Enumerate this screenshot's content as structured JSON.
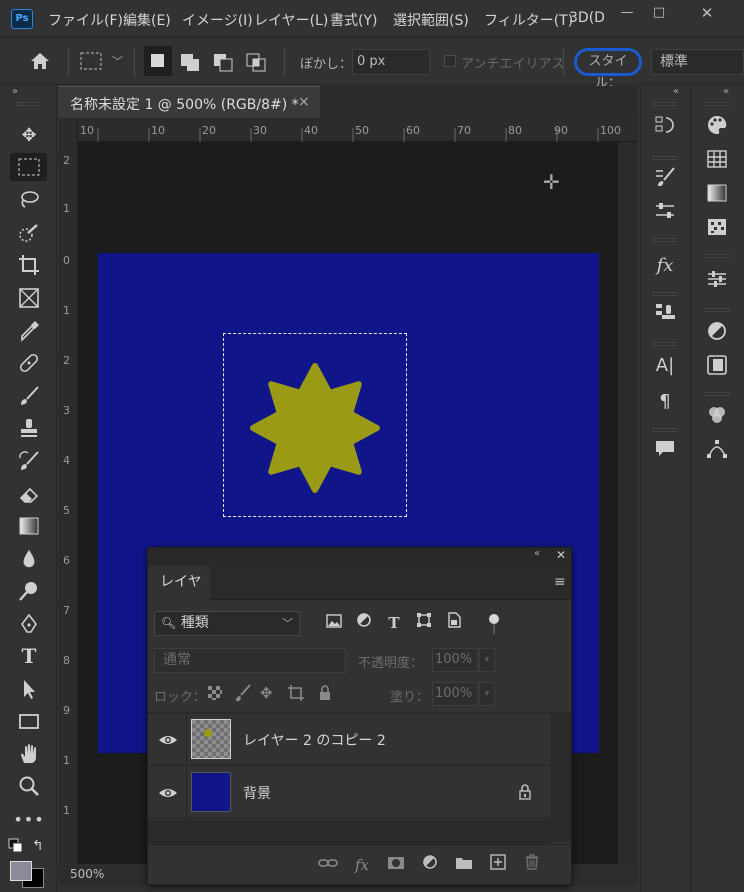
{
  "app": {
    "logo": "Ps"
  },
  "menu": [
    "ファイル(F)",
    "編集(E)",
    "イメージ(I)",
    "レイヤー(L)",
    "書式(Y)",
    "選択範囲(S)",
    "フィルター(T)",
    "3D(D"
  ],
  "window_controls": {
    "minimize": "—",
    "maximize": "□",
    "close": "✕"
  },
  "options": {
    "feather_label": "ぼかし：",
    "feather_value": "0 px",
    "antialias_label": "アンチエイリアス",
    "style_label": "スタイル：",
    "style_value": "標準"
  },
  "document": {
    "tab_title": "名称未設定 1 @ 500% (RGB/8#) *",
    "close": "×",
    "zoom": "500%",
    "canvas_color": "#10168a",
    "shape_color": "#9a9a14",
    "ruler_h_ticks": [
      "10",
      "10",
      "20",
      "30",
      "40",
      "50",
      "60",
      "70",
      "80",
      "90",
      "100"
    ],
    "ruler_v_ticks": [
      "2",
      "1",
      "0",
      "1",
      "2",
      "3",
      "4",
      "5",
      "6",
      "7",
      "8",
      "9",
      "1",
      "1"
    ]
  },
  "layers_panel": {
    "title": "レイヤー",
    "filter_kind": "種類",
    "blend_mode": "通常",
    "opacity_label": "不透明度：",
    "opacity_value": "100%",
    "lock_label": "ロック：",
    "fill_label": "塗り：",
    "fill_value": "100%",
    "layers": [
      {
        "name": "レイヤー 2 のコピー 2",
        "visible": true,
        "locked": false
      },
      {
        "name": "背景",
        "visible": true,
        "locked": true
      }
    ]
  },
  "icons": {
    "toolbar": [
      "move-icon",
      "marquee-icon",
      "lasso-icon",
      "quick-select-icon",
      "crop-icon",
      "frame-icon",
      "eyedropper-icon",
      "healing-icon",
      "brush-icon",
      "stamp-icon",
      "history-brush-icon",
      "eraser-icon",
      "gradient-icon",
      "blur-icon",
      "dodge-icon",
      "pen-icon",
      "type-icon",
      "path-select-icon",
      "rectangle-icon",
      "hand-icon",
      "zoom-icon",
      "more-icon"
    ]
  }
}
